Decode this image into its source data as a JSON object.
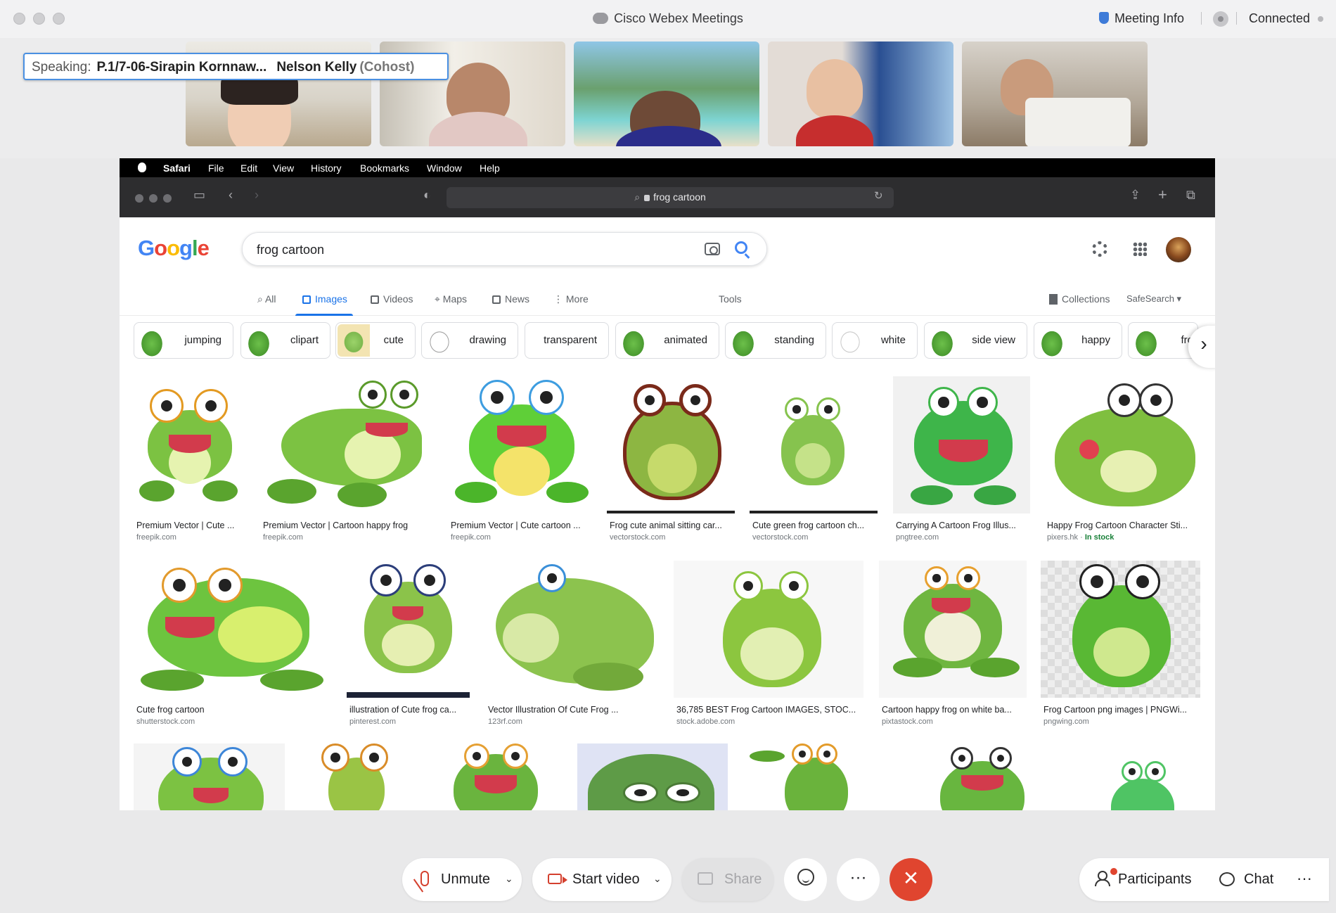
{
  "window": {
    "title": "Cisco Webex Meetings",
    "meeting_info": "Meeting Info",
    "status": "Connected"
  },
  "speaking": {
    "label": "Speaking:",
    "name": "P.1/7-06-Sirapin Kornnaw...",
    "host_name": "Nelson Kelly",
    "host_role": "(Cohost)"
  },
  "mac_menu": [
    "Safari",
    "File",
    "Edit",
    "View",
    "History",
    "Bookmarks",
    "Window",
    "Help"
  ],
  "safari": {
    "url": "frog cartoon"
  },
  "google": {
    "logo": "Google",
    "query": "frog cartoon",
    "tabs": [
      "All",
      "Images",
      "Videos",
      "Maps",
      "News",
      "More"
    ],
    "tools": "Tools",
    "collections": "Collections",
    "safesearch": "SafeSearch ▾",
    "chips": [
      "jumping",
      "clipart",
      "cute",
      "drawing",
      "transparent",
      "animated",
      "standing",
      "white",
      "side view",
      "happy",
      "fro"
    ],
    "results_row1": [
      {
        "title": "Premium Vector | Cute ...",
        "source": "freepik.com"
      },
      {
        "title": "Premium Vector | Cartoon happy frog",
        "source": "freepik.com"
      },
      {
        "title": "Premium Vector | Cute cartoon ...",
        "source": "freepik.com"
      },
      {
        "title": "Frog cute animal sitting car...",
        "source": "vectorstock.com"
      },
      {
        "title": "Cute green frog cartoon ch...",
        "source": "vectorstock.com"
      },
      {
        "title": "Carrying A Cartoon Frog Illus...",
        "source": "pngtree.com"
      },
      {
        "title": "Happy Frog Cartoon Character Sti...",
        "source": "pixers.hk",
        "stock": "In stock"
      }
    ],
    "results_row2": [
      {
        "title": "Cute frog cartoon",
        "source": "shutterstock.com"
      },
      {
        "title": "illustration of Cute frog ca...",
        "source": "pinterest.com"
      },
      {
        "title": "Vector Illustration Of Cute Frog ...",
        "source": "123rf.com"
      },
      {
        "title": "36,785 BEST Frog Cartoon IMAGES, STOC...",
        "source": "stock.adobe.com"
      },
      {
        "title": "Cartoon happy frog on white ba...",
        "source": "pixtastock.com"
      },
      {
        "title": "Frog Cartoon png images | PNGWi...",
        "source": "pngwing.com"
      }
    ]
  },
  "controls": {
    "unmute": "Unmute",
    "start_video": "Start video",
    "share": "Share",
    "participants": "Participants",
    "chat": "Chat",
    "more": "···",
    "end": "✕"
  }
}
